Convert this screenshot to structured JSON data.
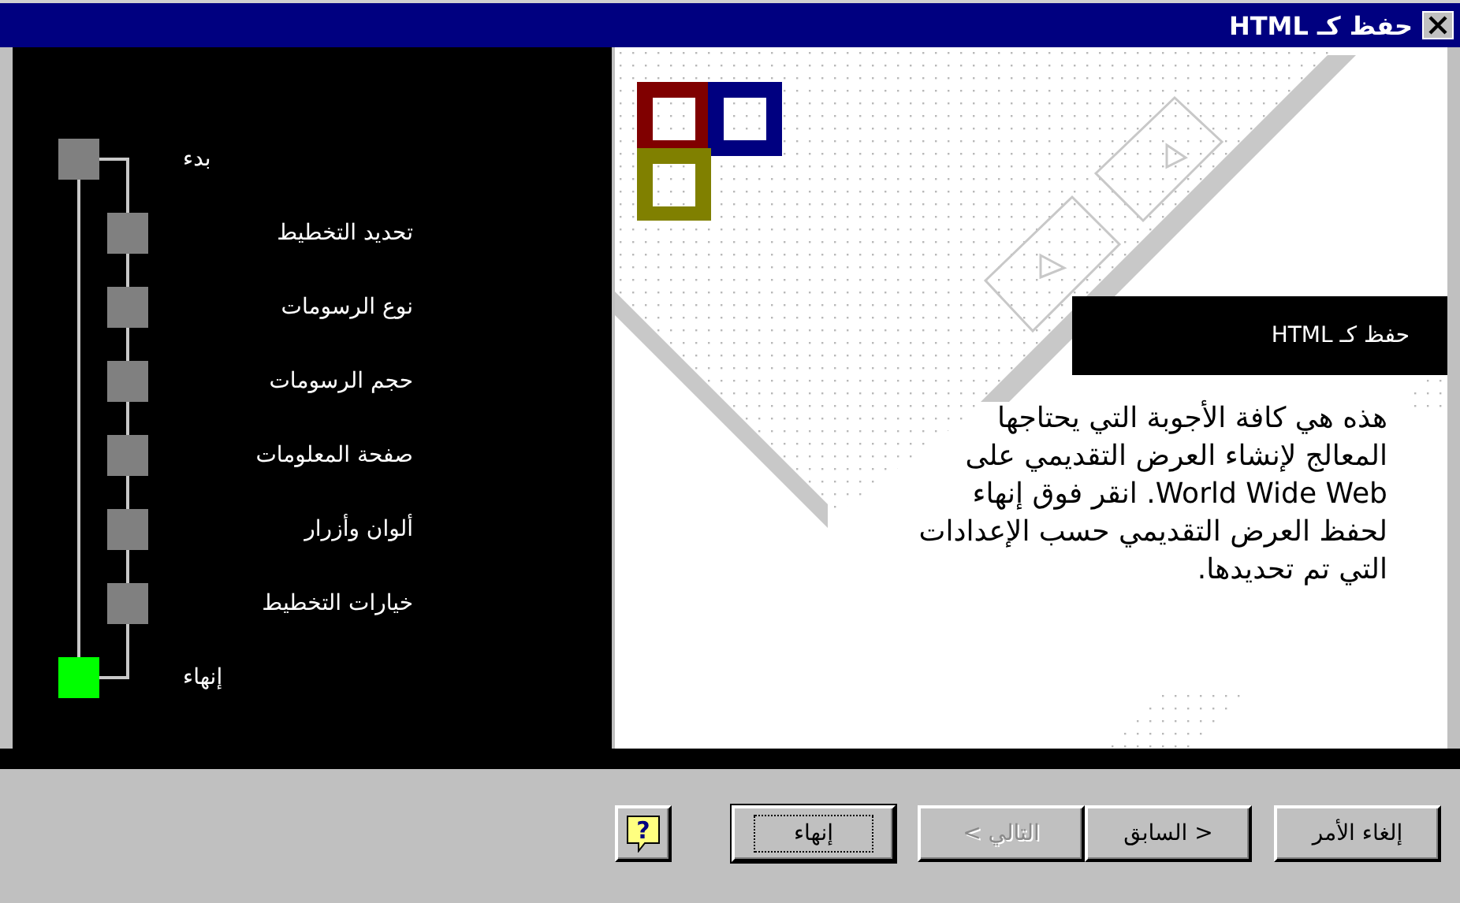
{
  "window": {
    "title": "حفظ كـ HTML"
  },
  "steps": [
    {
      "label": "بدء",
      "kind": "endpoint",
      "selected": false
    },
    {
      "label": "تحديد التخطيط",
      "kind": "step",
      "selected": false
    },
    {
      "label": "نوع الرسومات",
      "kind": "step",
      "selected": false
    },
    {
      "label": "حجم الرسومات",
      "kind": "step",
      "selected": false
    },
    {
      "label": "صفحة المعلومات",
      "kind": "step",
      "selected": false
    },
    {
      "label": "ألوان وأزرار",
      "kind": "step",
      "selected": false
    },
    {
      "label": "خيارات التخطيط",
      "kind": "step",
      "selected": false
    },
    {
      "label": "إنهاء",
      "kind": "endpoint",
      "selected": true
    }
  ],
  "page": {
    "heading": "حفظ كـ HTML",
    "text": "هذه هي كافة الأجوبة التي يحتاجها المعالج لإنشاء العرض التقديمي على World Wide Web.  انقر فوق إنهاء لحفظ العرض التقديمي حسب الإعدادات التي تم تحديدها."
  },
  "buttons": [
    {
      "label": "إلغاء الأمر",
      "kind": "button",
      "disabled": false
    },
    {
      "label": "< السابق",
      "kind": "button",
      "disabled": false
    },
    {
      "label": "التالي >",
      "kind": "button",
      "disabled": true
    },
    {
      "label": "إنهاء",
      "kind": "default",
      "disabled": false
    },
    {
      "label": "?",
      "kind": "help",
      "disabled": false
    }
  ]
}
